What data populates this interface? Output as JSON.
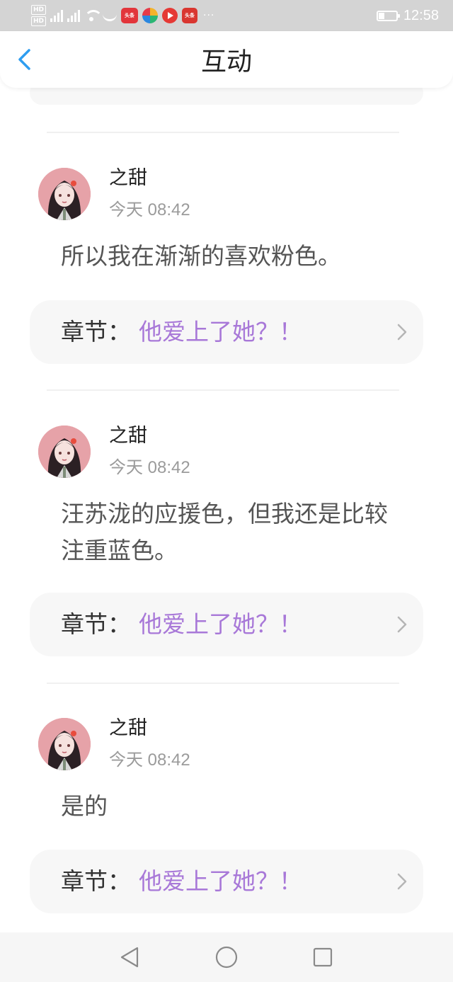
{
  "status_bar": {
    "hd_top": "HD",
    "hd_bottom": "HD",
    "net1": "4G",
    "net2": "4G",
    "app1_label": "头条",
    "app4_label": "头条",
    "more": "···",
    "time": "12:58"
  },
  "header": {
    "title": "互动",
    "accent_color": "#2e9df0"
  },
  "comments": [
    {
      "user": "之甜",
      "time": "今天 08:42",
      "text": "所以我在渐渐的喜欢粉色。",
      "chapter_label": "章节：",
      "chapter_title": "他爱上了她？！"
    },
    {
      "user": "之甜",
      "time": "今天 08:42",
      "text": "汪苏泷的应援色，但我还是比较注重蓝色。",
      "chapter_label": "章节：",
      "chapter_title": "他爱上了她？！"
    },
    {
      "user": "之甜",
      "time": "今天 08:42",
      "text": "是的",
      "chapter_label": "章节：",
      "chapter_title": "他爱上了她？！"
    }
  ],
  "nav_bar": {
    "back_icon": "triangle-back-icon",
    "home_icon": "circle-home-icon",
    "recent_icon": "square-recent-icon"
  }
}
